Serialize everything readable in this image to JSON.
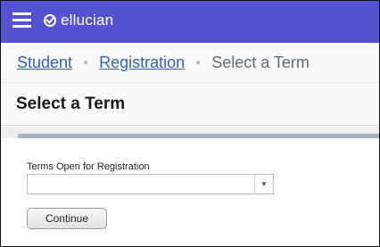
{
  "header": {
    "brand": "ellucian",
    "menu_icon": "hamburger-menu-icon",
    "logo_icon": "ellucian-logo-icon",
    "background": "#5353d1"
  },
  "breadcrumb": {
    "items": [
      "Student",
      "Registration"
    ],
    "current": "Select a Term",
    "separator_icon": "dot-separator-icon"
  },
  "page": {
    "title": "Select a Term"
  },
  "form": {
    "term_label": "Terms Open for Registration",
    "term_value": "",
    "dropdown_icon": "chevron-down-icon",
    "continue_label": "Continue"
  }
}
